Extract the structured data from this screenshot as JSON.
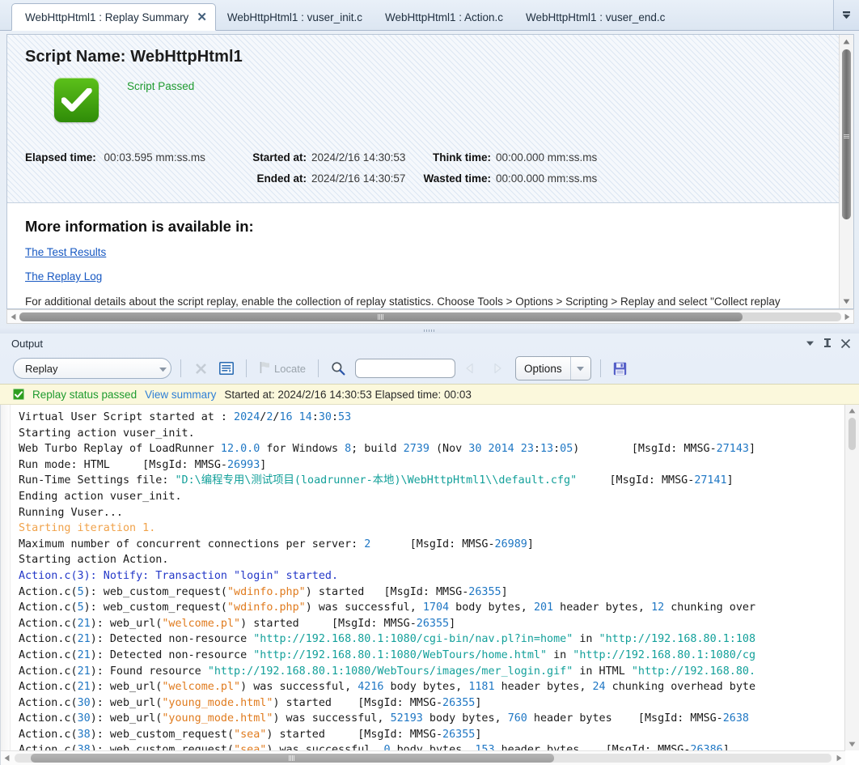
{
  "tabs": [
    {
      "label": "WebHttpHtml1 : Replay Summary",
      "active": true,
      "close": "✕"
    },
    {
      "label": "WebHttpHtml1 : vuser_init.c",
      "active": false
    },
    {
      "label": "WebHttpHtml1 : Action.c",
      "active": false
    },
    {
      "label": "WebHttpHtml1 : vuser_end.c",
      "active": false
    }
  ],
  "summary": {
    "script_name": "Script Name: WebHttpHtml1",
    "status_text": "Script Passed",
    "fields": {
      "elapsed_label": "Elapsed time:",
      "elapsed_value": "00:03.595 mm:ss.ms",
      "started_label": "Started at:",
      "started_value": "2024/2/16 14:30:53",
      "think_label": "Think time:",
      "think_value": "00:00.000 mm:ss.ms",
      "ended_label": "Ended at:",
      "ended_value": "2024/2/16 14:30:57",
      "wasted_label": "Wasted time:",
      "wasted_value": "00:00.000 mm:ss.ms"
    },
    "more_info_title": "More information is available in:",
    "link_test_results": "The Test Results",
    "link_replay_log": "The Replay Log",
    "note": "For additional details about the script replay, enable the collection of replay statistics. Choose Tools > Options > Scripting > Replay and select \"Collect replay"
  },
  "output": {
    "title": "Output",
    "toolbar": {
      "source_select": "Replay",
      "locate_label": "Locate",
      "find_value": "",
      "find_placeholder": "",
      "options_label": "Options"
    },
    "status": {
      "passed_text": "Replay status passed",
      "view_summary": "View summary",
      "info": "Started at: 2024/2/16 14:30:53 Elapsed time: 00:03"
    },
    "log": [
      [
        {
          "t": "Virtual User Script started at : "
        },
        {
          "t": "2024",
          "c": "n"
        },
        {
          "t": "/"
        },
        {
          "t": "2",
          "c": "n"
        },
        {
          "t": "/"
        },
        {
          "t": "16",
          "c": "n"
        },
        {
          "t": " "
        },
        {
          "t": "14",
          "c": "n"
        },
        {
          "t": ":"
        },
        {
          "t": "30",
          "c": "n"
        },
        {
          "t": ":"
        },
        {
          "t": "53",
          "c": "n"
        }
      ],
      [
        {
          "t": "Starting action vuser_init."
        }
      ],
      [
        {
          "t": "Web Turbo Replay of LoadRunner "
        },
        {
          "t": "12.0.0",
          "c": "n"
        },
        {
          "t": " for Windows "
        },
        {
          "t": "8",
          "c": "n"
        },
        {
          "t": "; build "
        },
        {
          "t": "2739",
          "c": "n"
        },
        {
          "t": " (Nov "
        },
        {
          "t": "30",
          "c": "n"
        },
        {
          "t": " "
        },
        {
          "t": "2014",
          "c": "n"
        },
        {
          "t": " "
        },
        {
          "t": "23",
          "c": "n"
        },
        {
          "t": ":"
        },
        {
          "t": "13",
          "c": "n"
        },
        {
          "t": ":"
        },
        {
          "t": "05",
          "c": "n"
        },
        {
          "t": ")        [MsgId: MMSG-"
        },
        {
          "t": "27143",
          "c": "n"
        },
        {
          "t": "]"
        }
      ],
      [
        {
          "t": "Run mode: HTML     [MsgId: MMSG-"
        },
        {
          "t": "26993",
          "c": "n"
        },
        {
          "t": "]"
        }
      ],
      [
        {
          "t": "Run-Time Settings file: "
        },
        {
          "t": "\"D:\\编程专用\\测试项目(loadrunner-本地)\\WebHttpHtml1\\\\default.cfg\"",
          "c": "u"
        },
        {
          "t": "     [MsgId: MMSG-"
        },
        {
          "t": "27141",
          "c": "n"
        },
        {
          "t": "]"
        }
      ],
      [
        {
          "t": "Ending action vuser_init."
        }
      ],
      [
        {
          "t": "Running Vuser..."
        }
      ],
      [
        {
          "t": "Starting iteration 1.",
          "c": "orange"
        }
      ],
      [
        {
          "t": "Maximum number of concurrent connections per server: "
        },
        {
          "t": "2",
          "c": "n"
        },
        {
          "t": "      [MsgId: MMSG-"
        },
        {
          "t": "26989",
          "c": "n"
        },
        {
          "t": "]"
        }
      ],
      [
        {
          "t": "Starting action Action."
        }
      ],
      [
        {
          "t": "Action.c(3): Notify: Transaction \"login\" started.",
          "c": "blue"
        }
      ],
      [
        {
          "t": "Action.c("
        },
        {
          "t": "5",
          "c": "n"
        },
        {
          "t": "): web_custom_request("
        },
        {
          "t": "\"wdinfo.php\"",
          "c": "s"
        },
        {
          "t": ") started   [MsgId: MMSG-"
        },
        {
          "t": "26355",
          "c": "n"
        },
        {
          "t": "]"
        }
      ],
      [
        {
          "t": "Action.c("
        },
        {
          "t": "5",
          "c": "n"
        },
        {
          "t": "): web_custom_request("
        },
        {
          "t": "\"wdinfo.php\"",
          "c": "s"
        },
        {
          "t": ") was successful, "
        },
        {
          "t": "1704",
          "c": "n"
        },
        {
          "t": " body bytes, "
        },
        {
          "t": "201",
          "c": "n"
        },
        {
          "t": " header bytes, "
        },
        {
          "t": "12",
          "c": "n"
        },
        {
          "t": " chunking over"
        }
      ],
      [
        {
          "t": "Action.c("
        },
        {
          "t": "21",
          "c": "n"
        },
        {
          "t": "): web_url("
        },
        {
          "t": "\"welcome.pl\"",
          "c": "s"
        },
        {
          "t": ") started     [MsgId: MMSG-"
        },
        {
          "t": "26355",
          "c": "n"
        },
        {
          "t": "]"
        }
      ],
      [
        {
          "t": "Action.c("
        },
        {
          "t": "21",
          "c": "n"
        },
        {
          "t": "): Detected non-resource "
        },
        {
          "t": "\"http://192.168.80.1:1080/cgi-bin/nav.pl?in=home\"",
          "c": "u"
        },
        {
          "t": " in "
        },
        {
          "t": "\"http://192.168.80.1:108",
          "c": "u"
        }
      ],
      [
        {
          "t": "Action.c("
        },
        {
          "t": "21",
          "c": "n"
        },
        {
          "t": "): Detected non-resource "
        },
        {
          "t": "\"http://192.168.80.1:1080/WebTours/home.html\"",
          "c": "u"
        },
        {
          "t": " in "
        },
        {
          "t": "\"http://192.168.80.1:1080/cg",
          "c": "u"
        }
      ],
      [
        {
          "t": "Action.c("
        },
        {
          "t": "21",
          "c": "n"
        },
        {
          "t": "): Found resource "
        },
        {
          "t": "\"http://192.168.80.1:1080/WebTours/images/mer_login.gif\"",
          "c": "u"
        },
        {
          "t": " in HTML "
        },
        {
          "t": "\"http://192.168.80.",
          "c": "u"
        }
      ],
      [
        {
          "t": "Action.c("
        },
        {
          "t": "21",
          "c": "n"
        },
        {
          "t": "): web_url("
        },
        {
          "t": "\"welcome.pl\"",
          "c": "s"
        },
        {
          "t": ") was successful, "
        },
        {
          "t": "4216",
          "c": "n"
        },
        {
          "t": " body bytes, "
        },
        {
          "t": "1181",
          "c": "n"
        },
        {
          "t": " header bytes, "
        },
        {
          "t": "24",
          "c": "n"
        },
        {
          "t": " chunking overhead byte"
        }
      ],
      [
        {
          "t": "Action.c("
        },
        {
          "t": "30",
          "c": "n"
        },
        {
          "t": "): web_url("
        },
        {
          "t": "\"young_mode.html\"",
          "c": "s"
        },
        {
          "t": ") started    [MsgId: MMSG-"
        },
        {
          "t": "26355",
          "c": "n"
        },
        {
          "t": "]"
        }
      ],
      [
        {
          "t": "Action.c("
        },
        {
          "t": "30",
          "c": "n"
        },
        {
          "t": "): web_url("
        },
        {
          "t": "\"young_mode.html\"",
          "c": "s"
        },
        {
          "t": ") was successful, "
        },
        {
          "t": "52193",
          "c": "n"
        },
        {
          "t": " body bytes, "
        },
        {
          "t": "760",
          "c": "n"
        },
        {
          "t": " header bytes    [MsgId: MMSG-"
        },
        {
          "t": "2638",
          "c": "n"
        }
      ],
      [
        {
          "t": "Action.c("
        },
        {
          "t": "38",
          "c": "n"
        },
        {
          "t": "): web_custom_request("
        },
        {
          "t": "\"sea\"",
          "c": "s"
        },
        {
          "t": ") started     [MsgId: MMSG-"
        },
        {
          "t": "26355",
          "c": "n"
        },
        {
          "t": "]"
        }
      ],
      [
        {
          "t": "Action.c("
        },
        {
          "t": "38",
          "c": "n"
        },
        {
          "t": "): web_custom_request("
        },
        {
          "t": "\"sea\"",
          "c": "s"
        },
        {
          "t": ") was successful, "
        },
        {
          "t": "0",
          "c": "n"
        },
        {
          "t": " body bytes, "
        },
        {
          "t": "153",
          "c": "n"
        },
        {
          "t": " header bytes    [MsgId: MMSG-"
        },
        {
          "t": "26386",
          "c": "n"
        },
        {
          "t": "]"
        }
      ]
    ]
  },
  "colors": {
    "pass_green": "#1f9b2f",
    "link_blue": "#1758c2",
    "number_blue": "#1f77c4",
    "string_orange": "#e07b1e",
    "url_teal": "#13a09a",
    "status_bg": "#fbf8dc"
  }
}
